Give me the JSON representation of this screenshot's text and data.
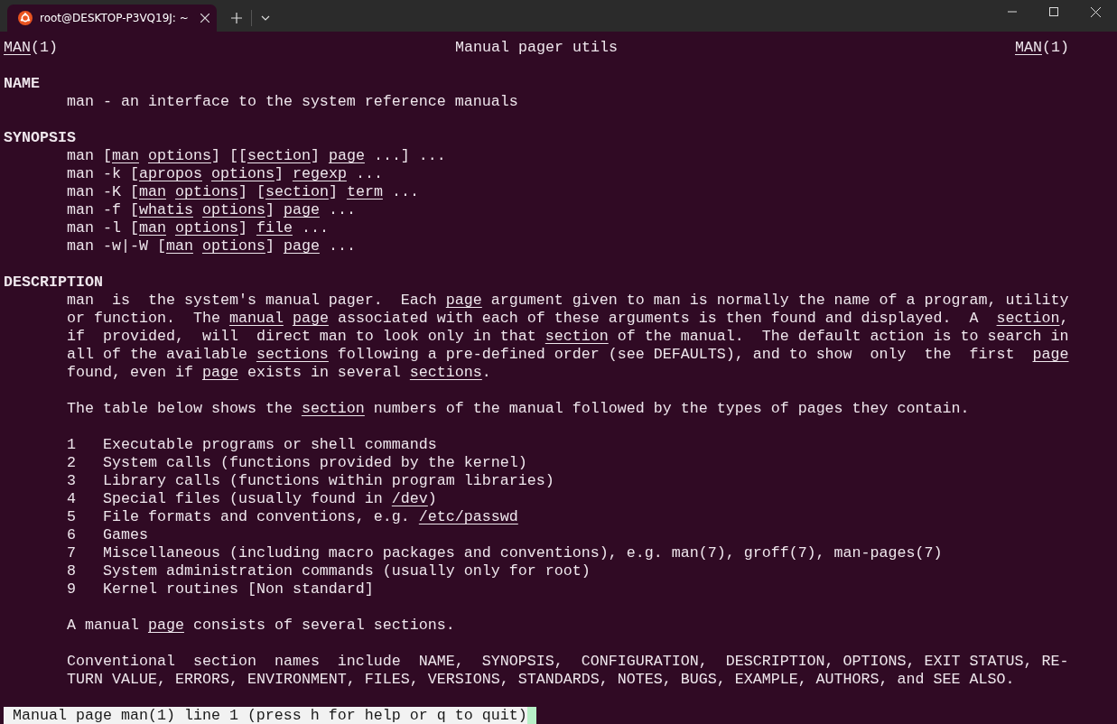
{
  "window": {
    "tab_title": "root@DESKTOP-P3VQ19J: ~"
  },
  "header": {
    "left": "*MAN*(1)",
    "center": "Manual pager utils",
    "right": "*MAN*(1)"
  },
  "lines": [
    {
      "kind": "blank"
    },
    {
      "kind": "heading",
      "text": "NAME"
    },
    {
      "kind": "body",
      "text": "man - an interface to the system reference manuals"
    },
    {
      "kind": "blank"
    },
    {
      "kind": "heading",
      "text": "SYNOPSIS"
    },
    {
      "kind": "body",
      "text": "man [*man* *options*] [[*section*] *page* ...] ..."
    },
    {
      "kind": "body",
      "text": "man -k [*apropos* *options*] *regexp* ..."
    },
    {
      "kind": "body",
      "text": "man -K [*man* *options*] [*section*] *term* ..."
    },
    {
      "kind": "body",
      "text": "man -f [*whatis* *options*] *page* ..."
    },
    {
      "kind": "body",
      "text": "man -l [*man* *options*] *file* ..."
    },
    {
      "kind": "body",
      "text": "man -w|-W [*man* *options*] *page* ..."
    },
    {
      "kind": "blank"
    },
    {
      "kind": "heading",
      "text": "DESCRIPTION"
    },
    {
      "kind": "body",
      "text": "man  is  the system's manual pager.  Each *page* argument given to man is normally the name of a program, utility"
    },
    {
      "kind": "body",
      "text": "or function.  The *manual* *page* associated with each of these arguments is then found and displayed.  A  *section*,"
    },
    {
      "kind": "body",
      "text": "if  provided,  will  direct man to look only in that *section* of the manual.  The default action is to search in"
    },
    {
      "kind": "body",
      "text": "all of the available *sections* following a pre-defined order (see DEFAULTS), and to show  only  the  first  *page*"
    },
    {
      "kind": "body",
      "text": "found, even if *page* exists in several *sections*."
    },
    {
      "kind": "blank"
    },
    {
      "kind": "body",
      "text": "The table below shows the *section* numbers of the manual followed by the types of pages they contain."
    },
    {
      "kind": "blank"
    },
    {
      "kind": "body",
      "text": "1   Executable programs or shell commands"
    },
    {
      "kind": "body",
      "text": "2   System calls (functions provided by the kernel)"
    },
    {
      "kind": "body",
      "text": "3   Library calls (functions within program libraries)"
    },
    {
      "kind": "body",
      "text": "4   Special files (usually found in */dev*)"
    },
    {
      "kind": "body",
      "text": "5   File formats and conventions, e.g. */etc/passwd*"
    },
    {
      "kind": "body",
      "text": "6   Games"
    },
    {
      "kind": "body",
      "text": "7   Miscellaneous (including macro packages and conventions), e.g. man(7), groff(7), man-pages(7)"
    },
    {
      "kind": "body",
      "text": "8   System administration commands (usually only for root)"
    },
    {
      "kind": "body",
      "text": "9   Kernel routines [Non standard]"
    },
    {
      "kind": "blank"
    },
    {
      "kind": "body",
      "text": "A manual *page* consists of several sections."
    },
    {
      "kind": "blank"
    },
    {
      "kind": "body",
      "text": "Conventional  section  names  include  NAME,  SYNOPSIS,  CONFIGURATION,  DESCRIPTION, OPTIONS, EXIT STATUS, RE-"
    },
    {
      "kind": "body",
      "text": "TURN VALUE, ERRORS, ENVIRONMENT, FILES, VERSIONS, STANDARDS, NOTES, BUGS, EXAMPLE, AUTHORS, and SEE ALSO."
    },
    {
      "kind": "blank"
    }
  ],
  "status_bar": {
    "text": " Manual page man(1) line 1 (press h for help or q to quit)"
  }
}
